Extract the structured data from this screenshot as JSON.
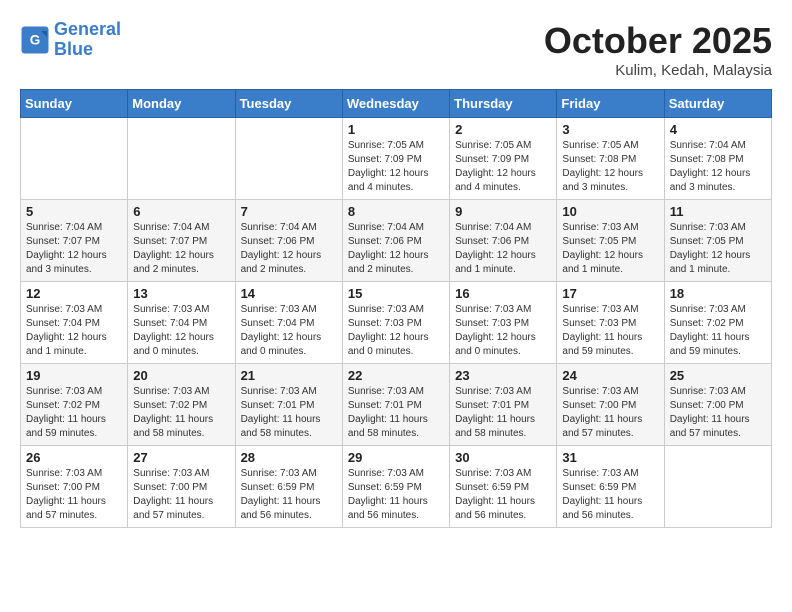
{
  "header": {
    "logo_line1": "General",
    "logo_line2": "Blue",
    "month": "October 2025",
    "location": "Kulim, Kedah, Malaysia"
  },
  "weekdays": [
    "Sunday",
    "Monday",
    "Tuesday",
    "Wednesday",
    "Thursday",
    "Friday",
    "Saturday"
  ],
  "weeks": [
    [
      {
        "day": "",
        "info": ""
      },
      {
        "day": "",
        "info": ""
      },
      {
        "day": "",
        "info": ""
      },
      {
        "day": "1",
        "info": "Sunrise: 7:05 AM\nSunset: 7:09 PM\nDaylight: 12 hours\nand 4 minutes."
      },
      {
        "day": "2",
        "info": "Sunrise: 7:05 AM\nSunset: 7:09 PM\nDaylight: 12 hours\nand 4 minutes."
      },
      {
        "day": "3",
        "info": "Sunrise: 7:05 AM\nSunset: 7:08 PM\nDaylight: 12 hours\nand 3 minutes."
      },
      {
        "day": "4",
        "info": "Sunrise: 7:04 AM\nSunset: 7:08 PM\nDaylight: 12 hours\nand 3 minutes."
      }
    ],
    [
      {
        "day": "5",
        "info": "Sunrise: 7:04 AM\nSunset: 7:07 PM\nDaylight: 12 hours\nand 3 minutes."
      },
      {
        "day": "6",
        "info": "Sunrise: 7:04 AM\nSunset: 7:07 PM\nDaylight: 12 hours\nand 2 minutes."
      },
      {
        "day": "7",
        "info": "Sunrise: 7:04 AM\nSunset: 7:06 PM\nDaylight: 12 hours\nand 2 minutes."
      },
      {
        "day": "8",
        "info": "Sunrise: 7:04 AM\nSunset: 7:06 PM\nDaylight: 12 hours\nand 2 minutes."
      },
      {
        "day": "9",
        "info": "Sunrise: 7:04 AM\nSunset: 7:06 PM\nDaylight: 12 hours\nand 1 minute."
      },
      {
        "day": "10",
        "info": "Sunrise: 7:03 AM\nSunset: 7:05 PM\nDaylight: 12 hours\nand 1 minute."
      },
      {
        "day": "11",
        "info": "Sunrise: 7:03 AM\nSunset: 7:05 PM\nDaylight: 12 hours\nand 1 minute."
      }
    ],
    [
      {
        "day": "12",
        "info": "Sunrise: 7:03 AM\nSunset: 7:04 PM\nDaylight: 12 hours\nand 1 minute."
      },
      {
        "day": "13",
        "info": "Sunrise: 7:03 AM\nSunset: 7:04 PM\nDaylight: 12 hours\nand 0 minutes."
      },
      {
        "day": "14",
        "info": "Sunrise: 7:03 AM\nSunset: 7:04 PM\nDaylight: 12 hours\nand 0 minutes."
      },
      {
        "day": "15",
        "info": "Sunrise: 7:03 AM\nSunset: 7:03 PM\nDaylight: 12 hours\nand 0 minutes."
      },
      {
        "day": "16",
        "info": "Sunrise: 7:03 AM\nSunset: 7:03 PM\nDaylight: 12 hours\nand 0 minutes."
      },
      {
        "day": "17",
        "info": "Sunrise: 7:03 AM\nSunset: 7:03 PM\nDaylight: 11 hours\nand 59 minutes."
      },
      {
        "day": "18",
        "info": "Sunrise: 7:03 AM\nSunset: 7:02 PM\nDaylight: 11 hours\nand 59 minutes."
      }
    ],
    [
      {
        "day": "19",
        "info": "Sunrise: 7:03 AM\nSunset: 7:02 PM\nDaylight: 11 hours\nand 59 minutes."
      },
      {
        "day": "20",
        "info": "Sunrise: 7:03 AM\nSunset: 7:02 PM\nDaylight: 11 hours\nand 58 minutes."
      },
      {
        "day": "21",
        "info": "Sunrise: 7:03 AM\nSunset: 7:01 PM\nDaylight: 11 hours\nand 58 minutes."
      },
      {
        "day": "22",
        "info": "Sunrise: 7:03 AM\nSunset: 7:01 PM\nDaylight: 11 hours\nand 58 minutes."
      },
      {
        "day": "23",
        "info": "Sunrise: 7:03 AM\nSunset: 7:01 PM\nDaylight: 11 hours\nand 58 minutes."
      },
      {
        "day": "24",
        "info": "Sunrise: 7:03 AM\nSunset: 7:00 PM\nDaylight: 11 hours\nand 57 minutes."
      },
      {
        "day": "25",
        "info": "Sunrise: 7:03 AM\nSunset: 7:00 PM\nDaylight: 11 hours\nand 57 minutes."
      }
    ],
    [
      {
        "day": "26",
        "info": "Sunrise: 7:03 AM\nSunset: 7:00 PM\nDaylight: 11 hours\nand 57 minutes."
      },
      {
        "day": "27",
        "info": "Sunrise: 7:03 AM\nSunset: 7:00 PM\nDaylight: 11 hours\nand 57 minutes."
      },
      {
        "day": "28",
        "info": "Sunrise: 7:03 AM\nSunset: 6:59 PM\nDaylight: 11 hours\nand 56 minutes."
      },
      {
        "day": "29",
        "info": "Sunrise: 7:03 AM\nSunset: 6:59 PM\nDaylight: 11 hours\nand 56 minutes."
      },
      {
        "day": "30",
        "info": "Sunrise: 7:03 AM\nSunset: 6:59 PM\nDaylight: 11 hours\nand 56 minutes."
      },
      {
        "day": "31",
        "info": "Sunrise: 7:03 AM\nSunset: 6:59 PM\nDaylight: 11 hours\nand 56 minutes."
      },
      {
        "day": "",
        "info": ""
      }
    ]
  ]
}
